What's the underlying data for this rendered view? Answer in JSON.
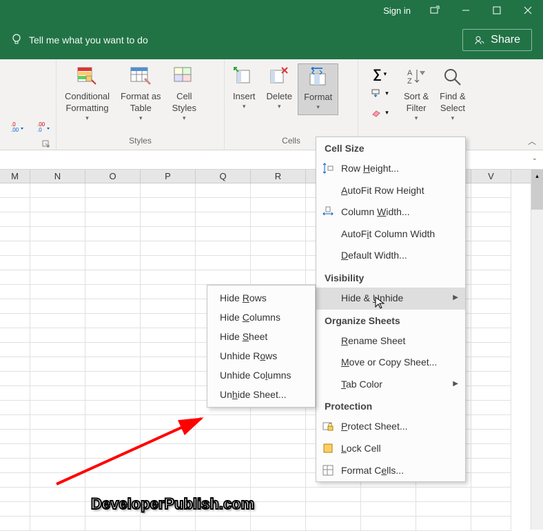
{
  "titlebar": {
    "signin": "Sign in"
  },
  "tellme": "Tell me what you want to do",
  "share": "Share",
  "ribbon": {
    "number": {
      "label": ""
    },
    "styles": {
      "label": "Styles",
      "cond": "Conditional\nFormatting",
      "table": "Format as\nTable",
      "cell": "Cell\nStyles"
    },
    "cells": {
      "label": "Cells",
      "insert": "Insert",
      "delete": "Delete",
      "format": "Format"
    },
    "editing": {
      "label": "",
      "sort": "Sort &\nFilter",
      "find": "Find &\nSelect"
    }
  },
  "columns": [
    "M",
    "N",
    "O",
    "P",
    "Q",
    "R",
    "",
    "",
    "",
    "V"
  ],
  "format_menu": {
    "cell_size": "Cell Size",
    "row_height": "Row Height...",
    "autofit_row": "AutoFit Row Height",
    "col_width": "Column Width...",
    "autofit_col": "AutoFit Column Width",
    "default_width": "Default Width...",
    "visibility": "Visibility",
    "hide_unhide": "Hide & Unhide",
    "organize": "Organize Sheets",
    "rename": "Rename Sheet",
    "move_copy": "Move or Copy Sheet...",
    "tab_color": "Tab Color",
    "protection": "Protection",
    "protect": "Protect Sheet...",
    "lock": "Lock Cell",
    "format_cells": "Format Cells..."
  },
  "submenu": {
    "hide_rows": "Hide Rows",
    "hide_cols": "Hide Columns",
    "hide_sheet": "Hide Sheet",
    "unhide_rows": "Unhide Rows",
    "unhide_cols": "Unhide Columns",
    "unhide_sheet": "Unhide Sheet..."
  },
  "watermark": "DeveloperPublish.com"
}
